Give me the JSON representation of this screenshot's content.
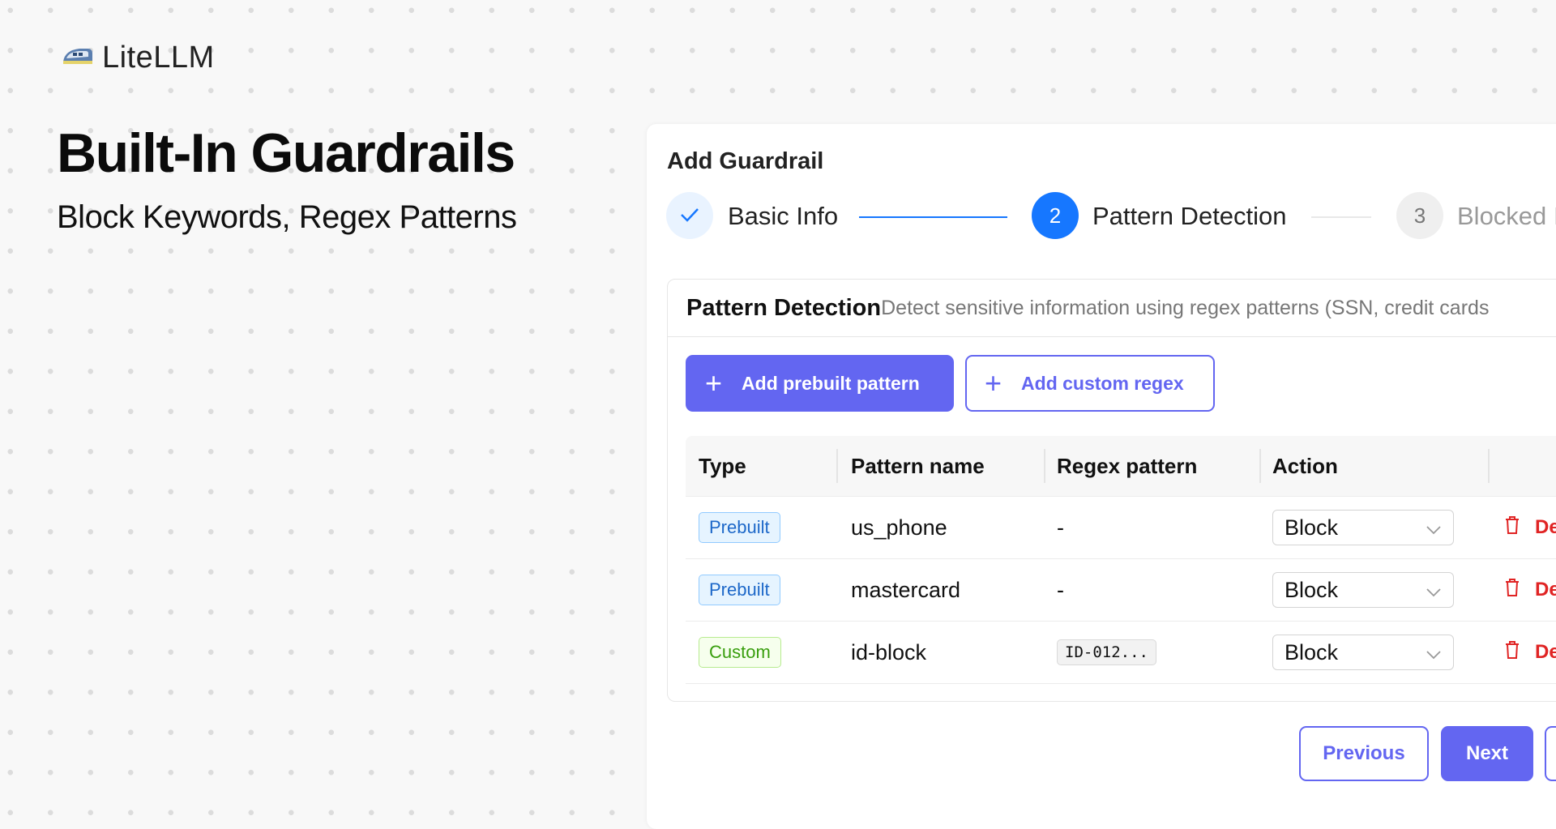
{
  "brand": {
    "name": "LiteLLM",
    "logo_icon": "bullet-train-icon"
  },
  "hero": {
    "title": "Built-In Guardrails",
    "subtitle": "Block Keywords, Regex Patterns"
  },
  "dialog": {
    "title": "Add Guardrail",
    "steps": [
      {
        "number": "1",
        "label": "Basic Info",
        "status": "done",
        "icon": "check-icon"
      },
      {
        "number": "2",
        "label": "Pattern Detection",
        "status": "active"
      },
      {
        "number": "3",
        "label": "Blocked I",
        "status": "pending"
      }
    ],
    "section": {
      "title": "Pattern Detection",
      "description": "Detect sensitive information using regex patterns (SSN, credit cards"
    },
    "buttons": {
      "add_prebuilt": "Add prebuilt pattern",
      "add_custom": "Add custom regex"
    },
    "table": {
      "columns": [
        "Type",
        "Pattern name",
        "Regex pattern",
        "Action"
      ],
      "rows": [
        {
          "type": "Prebuilt",
          "name": "us_phone",
          "regex": "-",
          "action": "Block",
          "delete": "Del"
        },
        {
          "type": "Prebuilt",
          "name": "mastercard",
          "regex": "-",
          "action": "Block",
          "delete": "Del"
        },
        {
          "type": "Custom",
          "name": "id-block",
          "regex": "ID-012...",
          "action": "Block",
          "delete": "Del"
        }
      ]
    },
    "footer": {
      "previous": "Previous",
      "next": "Next"
    }
  },
  "colors": {
    "accent": "#6366f1",
    "step_active": "#1677ff",
    "danger": "#e02424"
  }
}
